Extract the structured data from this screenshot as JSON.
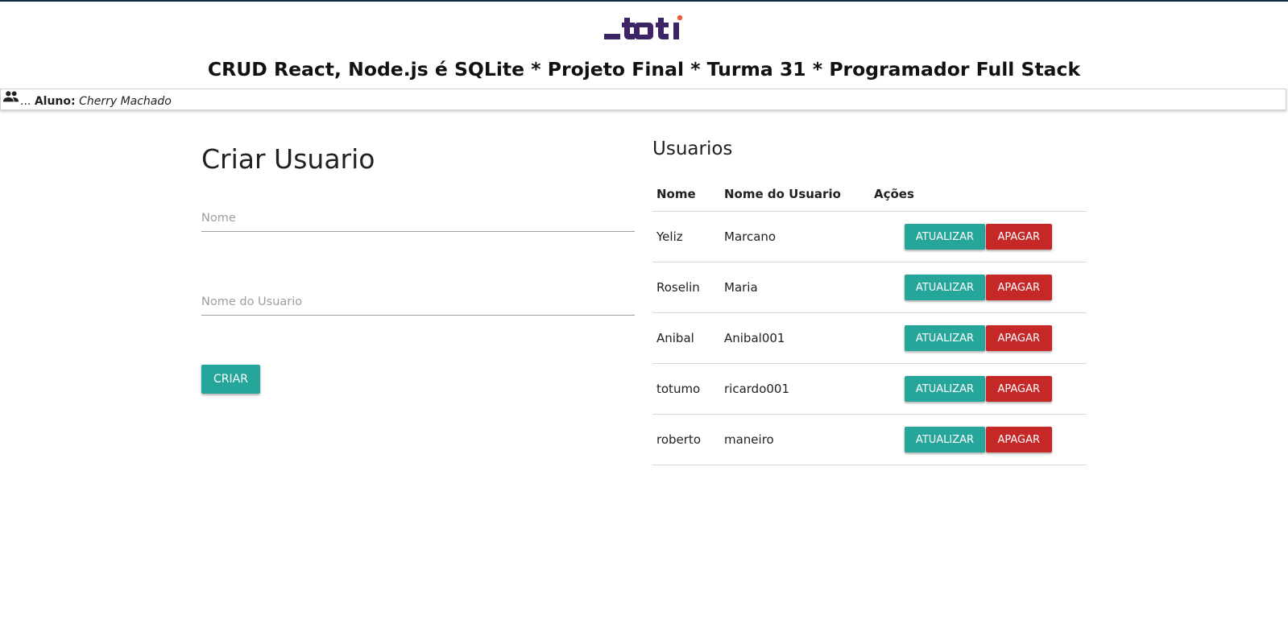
{
  "header": {
    "logo_text": "_toti",
    "title": "CRUD React, Node.js é SQLite * Projeto Final * Turma 31 * Programador Full Stack"
  },
  "student": {
    "icon": "people-icon",
    "prefix": "...",
    "label": "Aluno:",
    "name": "Cherry Machado"
  },
  "form": {
    "title": "Criar Usuario",
    "name_placeholder": "Nome",
    "name_value": "",
    "username_placeholder": "Nome do Usuario",
    "username_value": "",
    "create_label": "CRIAR"
  },
  "list": {
    "title": "Usuarios",
    "columns": [
      "Nome",
      "Nome do Usuario",
      "Ações"
    ],
    "update_label": "ATUALIZAR",
    "delete_label": "APAGAR",
    "rows": [
      {
        "name": "Yeliz",
        "username": "Marcano"
      },
      {
        "name": "Roselin",
        "username": "Maria"
      },
      {
        "name": "Anibal",
        "username": "Anibal001"
      },
      {
        "name": "totumo",
        "username": "ricardo001"
      },
      {
        "name": "roberto",
        "username": "maneiro"
      }
    ]
  },
  "colors": {
    "brand_purple": "#3d2466",
    "brand_dot": "#ef5a36",
    "teal": "#26a69a",
    "red": "#c62828"
  }
}
